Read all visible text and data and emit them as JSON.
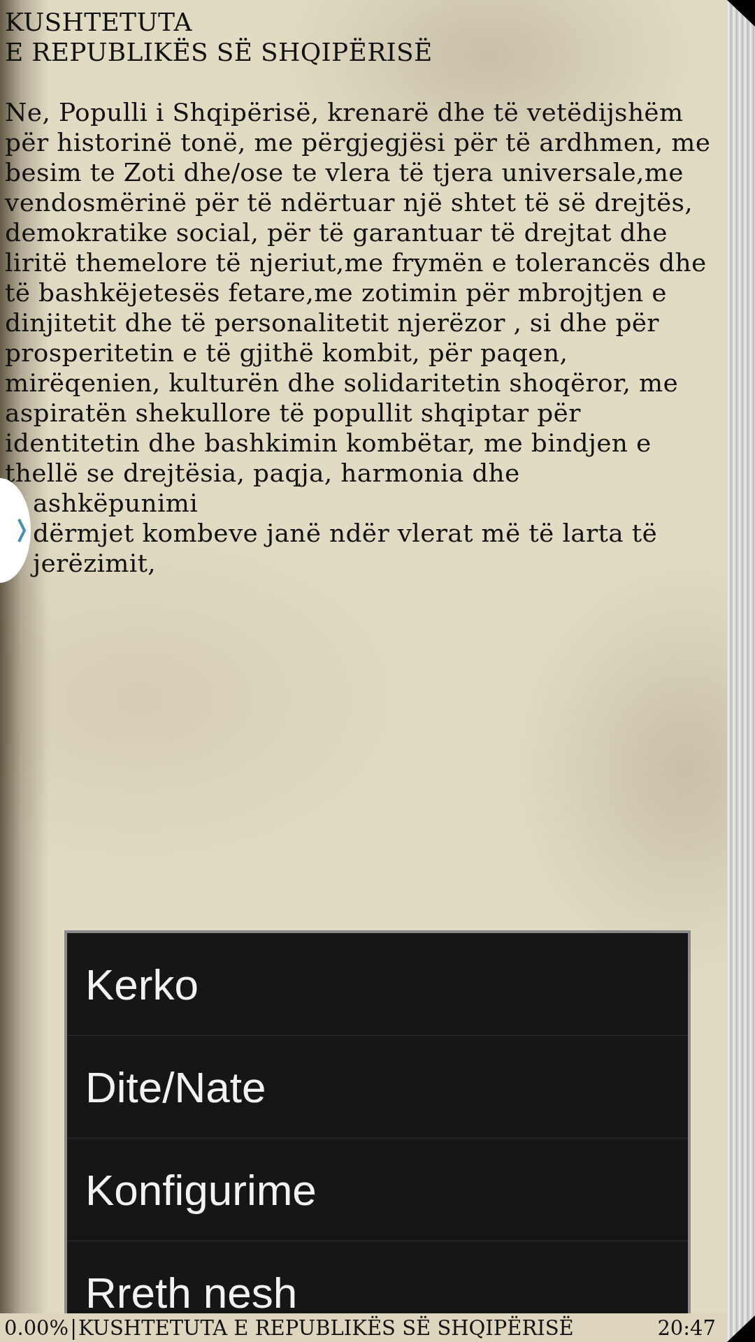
{
  "title_lines": [
    "KUSHTETUTA",
    "E REPUBLIKËS SË SHQIPËRISË"
  ],
  "body_lines": [
    {
      "text": "Ne, Populli i Shqipërisë, krenarë dhe të vetëdijshëm",
      "covered": false
    },
    {
      "text": "për historinë tonë, me përgjegjësi për të ardhmen, me",
      "covered": false
    },
    {
      "text": "besim te Zoti dhe/ose te vlera të tjera universale,me",
      "covered": false
    },
    {
      "text": "vendosmërinë për të ndërtuar një shtet të së drejtës,",
      "covered": false
    },
    {
      "text": "demokratike social, për të garantuar të drejtat dhe",
      "covered": false
    },
    {
      "text": "liritë themelore të njeriut,me frymën e tolerancës dhe",
      "covered": false
    },
    {
      "text": "të bashkëjetesës fetare,me zotimin për mbrojtjen e",
      "covered": false
    },
    {
      "text": "dinjitetit dhe të personalitetit njerëzor , si dhe për",
      "covered": false
    },
    {
      "text": "prosperitetin e të gjithë kombit,  për paqen,",
      "covered": false
    },
    {
      "text": "mirëqenien, kulturën dhe solidaritetin shoqëror, me",
      "covered": false
    },
    {
      "text": "aspiratën shekullore të popullit shqiptar për",
      "covered": false
    },
    {
      "text": "identitetin dhe bashkimin kombëtar, me bindjen e",
      "covered": false
    },
    {
      "text": "thellë se drejtësia, paqja, harmonia dhe",
      "covered": false
    },
    {
      "text": "ashkëpunimi",
      "covered": true
    },
    {
      "text": "dërmjet kombeve janë ndër vlerat më të larta të",
      "covered": true
    },
    {
      "text": "jerëzimit,",
      "covered": true
    }
  ],
  "menu": [
    {
      "label": "Kerko"
    },
    {
      "label": "Dite/Nate"
    },
    {
      "label": "Konfigurime"
    },
    {
      "label": "Rreth nesh"
    }
  ],
  "status_bar": {
    "progress": "0.00%",
    "separator": "|",
    "book_title": "KUSHTETUTA E REPUBLIKËS SË SHQIPËRISË",
    "time": "20:47"
  }
}
